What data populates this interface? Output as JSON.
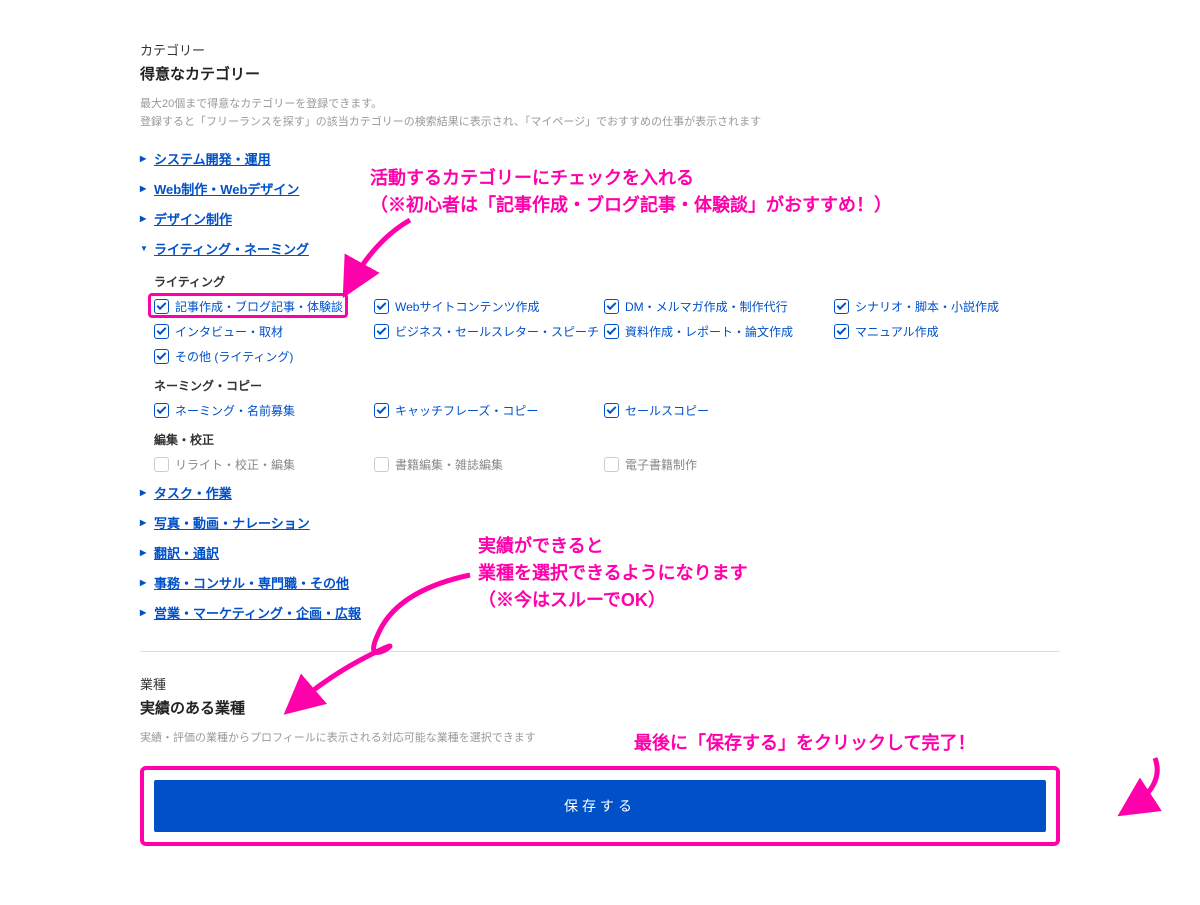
{
  "header": {
    "label": "カテゴリー",
    "title": "得意なカテゴリー",
    "desc_line1": "最大20個まで得意なカテゴリーを登録できます。",
    "desc_line2": "登録すると「フリーランスを探す」の該当カテゴリーの検索結果に表示され、「マイページ」でおすすめの仕事が表示されます"
  },
  "categories": {
    "c0": "システム開発・運用",
    "c1": "Web制作・Webデザイン",
    "c2": "デザイン制作",
    "c3": "ライティング・ネーミング",
    "c4": "タスク・作業",
    "c5": "写真・動画・ナレーション",
    "c6": "翻訳・通訳",
    "c7": "事務・コンサル・専門職・その他",
    "c8": "営業・マーケティング・企画・広報"
  },
  "writing": {
    "h1": "ライティング",
    "i0": "記事作成・ブログ記事・体験談",
    "i1": "Webサイトコンテンツ作成",
    "i2": "DM・メルマガ作成・制作代行",
    "i3": "シナリオ・脚本・小説作成",
    "i4": "インタビュー・取材",
    "i5": "ビジネス・セールスレター・スピーチ",
    "i6": "資料作成・レポート・論文作成",
    "i7": "マニュアル作成",
    "i8": "その他 (ライティング)",
    "h2": "ネーミング・コピー",
    "n0": "ネーミング・名前募集",
    "n1": "キャッチフレーズ・コピー",
    "n2": "セールスコピー",
    "h3": "編集・校正",
    "e0": "リライト・校正・編集",
    "e1": "書籍編集・雑誌編集",
    "e2": "電子書籍制作"
  },
  "industry": {
    "label": "業種",
    "title": "実績のある業種",
    "desc": "実績・評価の業種からプロフィールに表示される対応可能な業種を選択できます"
  },
  "save_label": "保存する",
  "annotations": {
    "a1_l1": "活動するカテゴリーにチェックを入れる",
    "a1_l2": "（※初心者は「記事作成・ブログ記事・体験談」がおすすめ！）",
    "a2_l1": "実績ができると",
    "a2_l2": "業種を選択できるようになります",
    "a2_l3": "（※今はスルーでOK）",
    "a3": "最後に「保存する」をクリックして完了！"
  },
  "colors": {
    "brand_blue": "#0050c8",
    "anno_pink": "#ff00aa"
  }
}
